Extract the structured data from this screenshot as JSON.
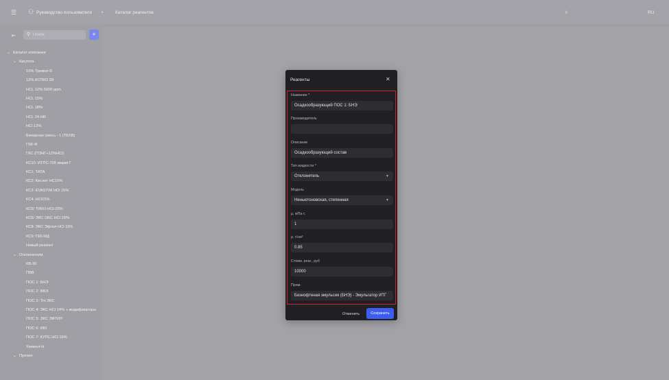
{
  "topbar": {
    "menu_icon": "menu-icon",
    "breadcrumb_icon": "user-guide-icon",
    "breadcrumb_1": "Руководство пользователя",
    "breadcrumb_sep": "•",
    "breadcrumb_2": "Каталог реагентов",
    "bulb_icon": "lightbulb-icon",
    "language": "RU"
  },
  "sidebar": {
    "collapse_icon": "collapse-icon",
    "search_placeholder": "Поиск",
    "add_label": "+",
    "tree": [
      {
        "level": 0,
        "chev": "⌄",
        "label": "Каталог компании"
      },
      {
        "level": 1,
        "chev": "⌄",
        "label": "Кислота"
      },
      {
        "level": 2,
        "chev": "",
        "label": "10% Тримол Б"
      },
      {
        "level": 2,
        "chev": "",
        "label": "12% КСПКО 28"
      },
      {
        "level": 2,
        "chev": "",
        "label": "HCL 12% 5000 ppm"
      },
      {
        "level": 2,
        "chev": "",
        "label": "HCL 15%"
      },
      {
        "level": 2,
        "chev": "",
        "label": "HCL 18%"
      },
      {
        "level": 2,
        "chev": "",
        "label": "HCL 24 HR"
      },
      {
        "level": 2,
        "chev": "",
        "label": "HCl 12%"
      },
      {
        "level": 2,
        "chev": "",
        "label": "Бинарная смесь - 1 (ТБХВ)"
      },
      {
        "level": 2,
        "chev": "",
        "label": "ГБК-Ф"
      },
      {
        "level": 2,
        "chev": "",
        "label": "ГКС (ПЭНГ+12%HCl)"
      },
      {
        "level": 2,
        "chev": "",
        "label": "КС10: ИТПС-705 марки Г"
      },
      {
        "level": 2,
        "chev": "",
        "label": "КС1: ТАТА"
      },
      {
        "level": 2,
        "chev": "",
        "label": "КС2: Кислит НС15%"
      },
      {
        "level": 2,
        "chev": "",
        "label": "КС3: EVASTIM HCl 15%"
      },
      {
        "level": 2,
        "chev": "",
        "label": "КС4: HCl15%"
      },
      {
        "level": 2,
        "chev": "",
        "label": "КС5/ ТИКО-НСl-20%"
      },
      {
        "level": 2,
        "chev": "",
        "label": "КС6/ ЭКС ОБС HCl 15%"
      },
      {
        "level": 2,
        "chev": "",
        "label": "КС8: ЭКС Эфтил HCl 15%"
      },
      {
        "level": 2,
        "chev": "",
        "label": "КС9: ГКК-МД"
      },
      {
        "level": 2,
        "chev": "",
        "label": "Новый реагент"
      },
      {
        "level": 1,
        "chev": "⌄",
        "label": "Отклонители"
      },
      {
        "level": 2,
        "chev": "",
        "label": "КВ-30"
      },
      {
        "level": 2,
        "chev": "",
        "label": "ПВВ"
      },
      {
        "level": 2,
        "chev": "",
        "label": "ПОС 1: БНЭ"
      },
      {
        "level": 2,
        "chev": "",
        "label": "ПОС 2: ВВЭ"
      },
      {
        "level": 2,
        "chev": "",
        "label": "ПОС 3: ТН-ЭКС"
      },
      {
        "level": 2,
        "chev": "",
        "label": "ПОС 4: ЭКС НСl 14% + модификаторы"
      },
      {
        "level": 2,
        "chev": "",
        "label": "ПОС 5: ЭКС ЭФТИЛ"
      },
      {
        "level": 2,
        "chev": "",
        "label": "ПОС 6: ИЮ"
      },
      {
        "level": 2,
        "chev": "",
        "label": "ПОС 7: КУПС НСl 15%"
      },
      {
        "level": 2,
        "chev": "",
        "label": "Химеол-Н"
      },
      {
        "level": 1,
        "chev": "⌄",
        "label": "Прочее"
      }
    ]
  },
  "modal": {
    "title": "Реагенты",
    "close_icon": "close-icon",
    "fields": [
      {
        "label": "Название *",
        "value": "Осадкообразующий ПОС 1: БНЭ",
        "select": false
      },
      {
        "label": "Производитель",
        "value": "",
        "select": false
      },
      {
        "label": "Описание",
        "value": "Осадкообразующий состав",
        "select": false
      },
      {
        "label": "Тип жидкости *",
        "value": "Отклонитель",
        "select": true
      },
      {
        "label": "Модель",
        "value": "Неньютоновская, степенная",
        "select": true
      },
      {
        "label": "μ, мПа·с",
        "value": "1",
        "select": false
      },
      {
        "label": "ρ, г/см³",
        "value": "0.85",
        "select": false
      },
      {
        "label": "Стоим. реаг., руб",
        "value": "10000",
        "select": false
      },
      {
        "label": "Прим.",
        "value": "Безнофтеная эмульсия (БНЭ) - Эмульгатор ИТГ",
        "select": false
      }
    ],
    "cancel_label": "Отменить",
    "save_label": "Сохранить"
  }
}
